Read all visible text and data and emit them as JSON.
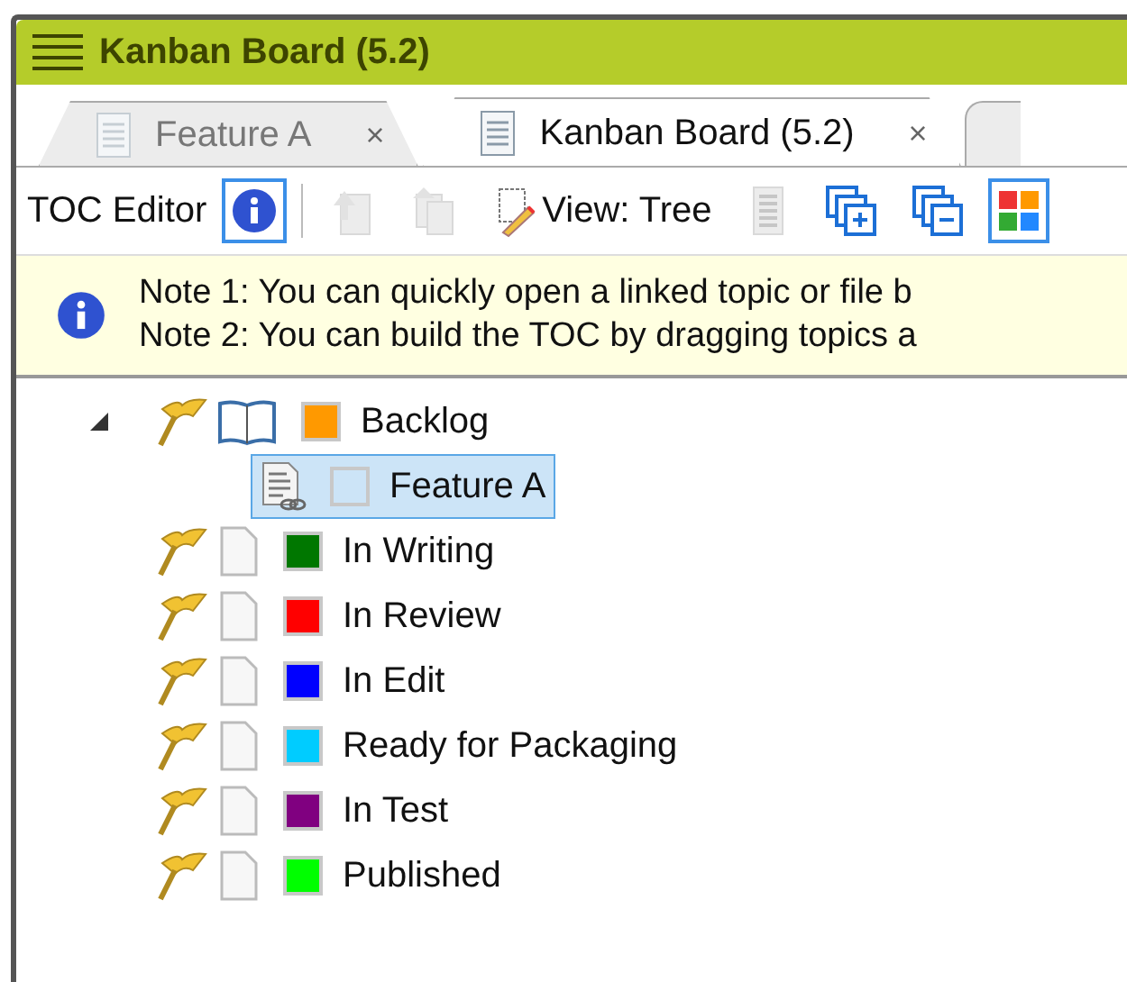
{
  "window": {
    "title": "Kanban Board (5.2)"
  },
  "tabs": [
    {
      "label": "Feature A",
      "selected": false,
      "close": "×"
    },
    {
      "label": "Kanban Board (5.2)",
      "selected": true,
      "close": "×"
    }
  ],
  "toolbar": {
    "label": "TOC Editor",
    "buttons": [
      {
        "kind": "info",
        "selected": true,
        "disabled": false
      },
      {
        "kind": "separator"
      },
      {
        "kind": "move-up",
        "selected": false,
        "disabled": true
      },
      {
        "kind": "move-down",
        "selected": false,
        "disabled": true
      },
      {
        "kind": "view",
        "label": "View: Tree",
        "selected": false,
        "disabled": false
      },
      {
        "kind": "list",
        "selected": false,
        "disabled": true
      },
      {
        "kind": "expand",
        "selected": false,
        "disabled": false
      },
      {
        "kind": "collapse",
        "selected": false,
        "disabled": false
      },
      {
        "kind": "colors",
        "selected": true,
        "disabled": false
      }
    ]
  },
  "notes": [
    "Note 1: You can quickly open a linked topic or file b",
    "Note 2: You can build the TOC by dragging topics a"
  ],
  "tree": [
    {
      "label": "Backlog",
      "kind": "book",
      "color": "#ff9900",
      "expanded": true,
      "selected": false,
      "children": [
        {
          "label": "Feature A",
          "kind": "linked-topic",
          "selected": true
        }
      ]
    },
    {
      "label": "In Writing",
      "kind": "page",
      "color": "#007700",
      "selected": false
    },
    {
      "label": "In Review",
      "kind": "page",
      "color": "#ff0000",
      "selected": false
    },
    {
      "label": "In Edit",
      "kind": "page",
      "color": "#0000ff",
      "selected": false
    },
    {
      "label": "Ready for Packaging",
      "kind": "page",
      "color": "#00ccff",
      "selected": false
    },
    {
      "label": "In Test",
      "kind": "page",
      "color": "#800080",
      "selected": false
    },
    {
      "label": "Published",
      "kind": "page",
      "color": "#00ff00",
      "selected": false
    }
  ]
}
